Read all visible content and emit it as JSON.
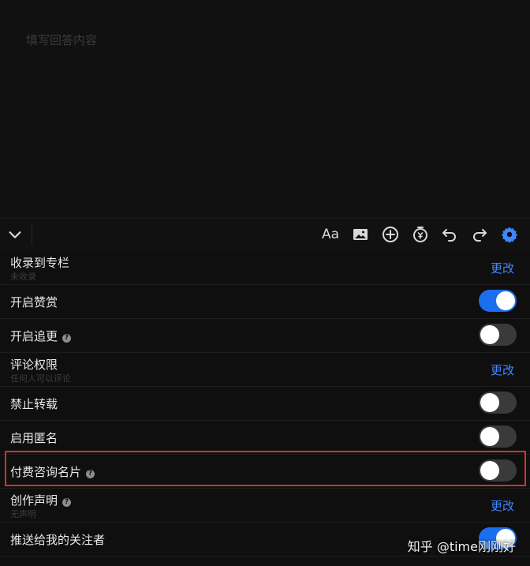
{
  "editor": {
    "placeholder": "填写回答内容"
  },
  "toolbar": {
    "icons": [
      "chevron-down-icon",
      "font-size-icon",
      "image-icon",
      "add-circle-icon",
      "reward-icon",
      "undo-icon",
      "redo-icon",
      "settings-gear-icon"
    ],
    "font_label": "Aa"
  },
  "settings": {
    "column": {
      "label": "收录到专栏",
      "sub": "未收录",
      "action": "更改"
    },
    "reward": {
      "label": "开启赞赏",
      "toggle": "on"
    },
    "followup": {
      "label": "开启追更",
      "help": "?",
      "toggle": "off"
    },
    "comments": {
      "label": "评论权限",
      "sub": "任何人可以评论",
      "action": "更改"
    },
    "no_repost": {
      "label": "禁止转载",
      "toggle": "off"
    },
    "anonymous": {
      "label": "启用匿名",
      "toggle": "off"
    },
    "paid_card": {
      "label": "付费咨询名片",
      "help": "?",
      "toggle": "off"
    },
    "declaration": {
      "label": "创作声明",
      "help": "?",
      "sub": "无声明",
      "action": "更改"
    },
    "push_followers": {
      "label": "推送给我的关注者",
      "toggle": "on"
    }
  },
  "watermark": "知乎 @time刚刚好",
  "colors": {
    "accent": "#3f86ff",
    "toggle_on": "#1b6ef0",
    "highlight": "#d7302f"
  }
}
